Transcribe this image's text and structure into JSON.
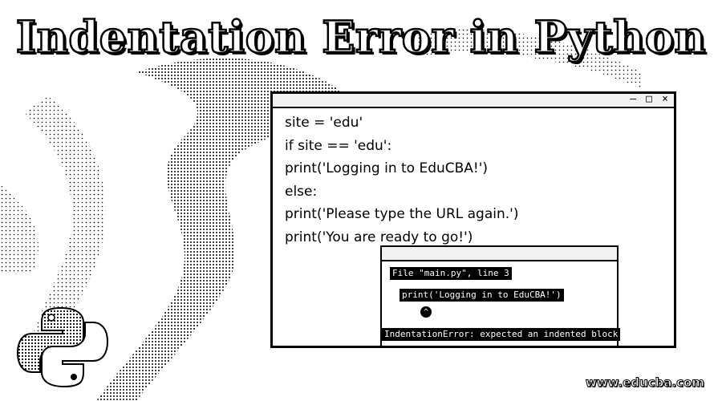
{
  "title": "Indentation Error in Python",
  "editor": {
    "controls": [
      "–",
      "□",
      "×"
    ],
    "code_lines": [
      "site = 'edu'",
      "if site == 'edu':",
      "print('Logging in to EduCBA!')",
      "else:",
      "print('Please type the URL again.')",
      "print('You are ready to go!')"
    ]
  },
  "console": {
    "file_line": "File \"main.py\", line 3",
    "code_line": "print('Logging in to EduCBA!')",
    "caret": "^",
    "error_line": "IndentationError: expected an indented block"
  },
  "logo": {
    "icon": "python-logo-icon"
  },
  "website": "www.educba.com"
}
